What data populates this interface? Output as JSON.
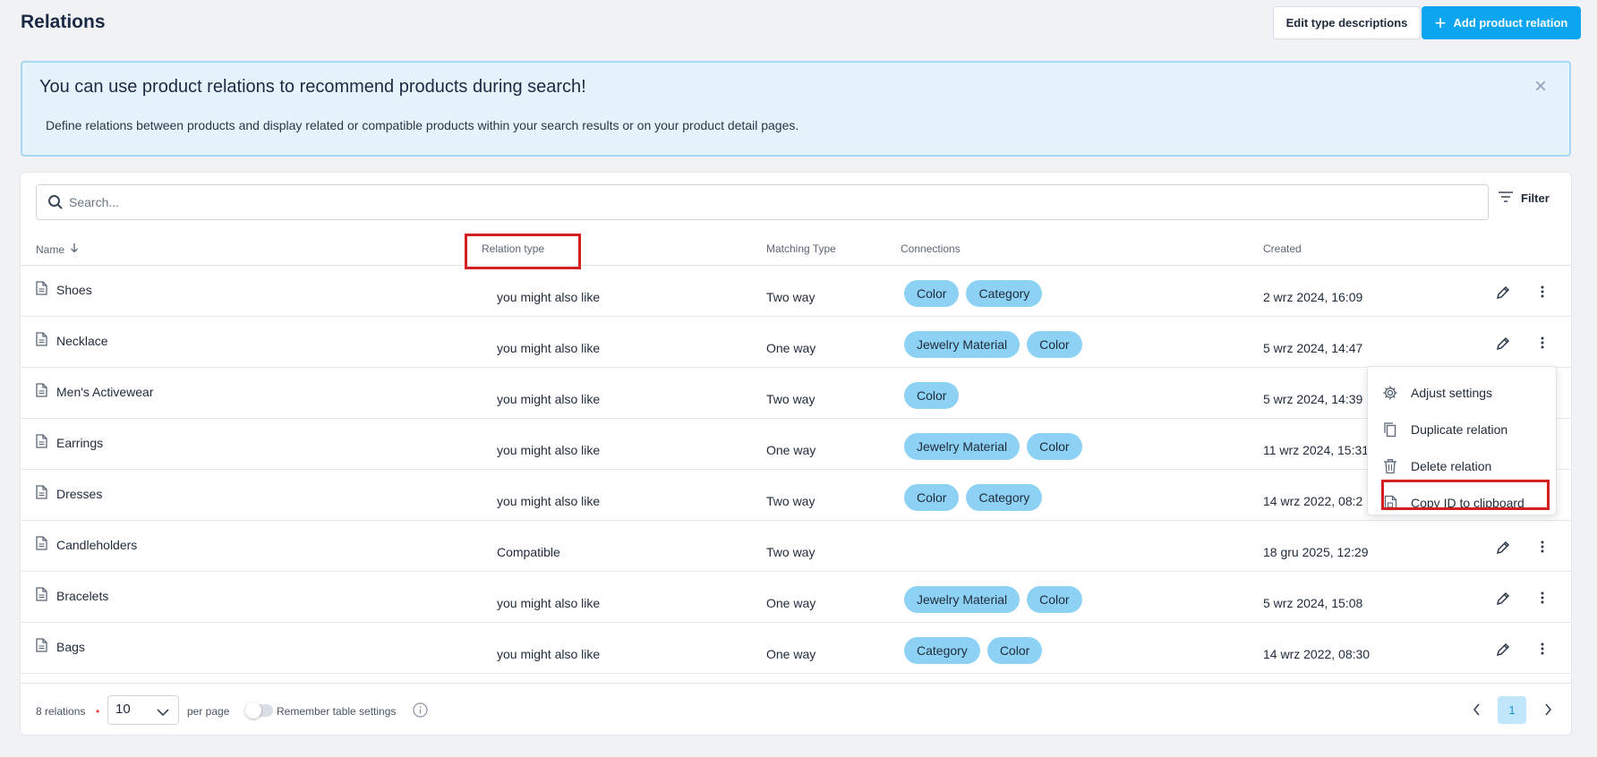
{
  "header": {
    "title": "Relations",
    "edit_button": "Edit type descriptions",
    "add_button": "Add product relation"
  },
  "banner": {
    "title": "You can use product relations to recommend products during search!",
    "text": "Define relations between products and display related or compatible products within your search results or on your product detail pages.",
    "close_glyph": "×"
  },
  "search": {
    "placeholder": "Search..."
  },
  "filter": {
    "label": "Filter"
  },
  "table": {
    "columns": {
      "name": "Name",
      "relation_type": "Relation type",
      "matching_type": "Matching Type",
      "connections": "Connections",
      "created": "Created"
    },
    "rows": [
      {
        "name": "Shoes",
        "relation": "you might also like",
        "matching": "Two way",
        "connections": [
          "Color",
          "Category"
        ],
        "created": "2 wrz 2024, 16:09"
      },
      {
        "name": "Necklace",
        "relation": "you might also like",
        "matching": "One way",
        "connections": [
          "Jewelry Material",
          "Color"
        ],
        "created": "5 wrz 2024, 14:47"
      },
      {
        "name": "Men's Activewear",
        "relation": "you might also like",
        "matching": "Two way",
        "connections": [
          "Color"
        ],
        "created": "5 wrz 2024, 14:39"
      },
      {
        "name": "Earrings",
        "relation": "you might also like",
        "matching": "One way",
        "connections": [
          "Jewelry Material",
          "Color"
        ],
        "created": "11 wrz 2024, 15:31"
      },
      {
        "name": "Dresses",
        "relation": "you might also like",
        "matching": "Two way",
        "connections": [
          "Color",
          "Category"
        ],
        "created": "14 wrz 2022, 08:2"
      },
      {
        "name": "Candleholders",
        "relation": "Compatible",
        "matching": "Two way",
        "connections": [],
        "created": "18 gru 2025, 12:29"
      },
      {
        "name": "Bracelets",
        "relation": "you might also like",
        "matching": "One way",
        "connections": [
          "Jewelry Material",
          "Color"
        ],
        "created": "5 wrz 2024, 15:08"
      },
      {
        "name": "Bags",
        "relation": "you might also like",
        "matching": "One way",
        "connections": [
          "Category",
          "Color"
        ],
        "created": "14 wrz 2022, 08:30"
      }
    ]
  },
  "context_menu": {
    "items": [
      "Adjust settings",
      "Duplicate relation",
      "Delete relation",
      "Copy ID to clipboard"
    ],
    "icons": [
      "gear-icon",
      "copy-icon",
      "trash-icon",
      "clipboard-icon"
    ]
  },
  "footer": {
    "count": "8 relations",
    "dot": "•",
    "per_page_value": "10",
    "per_page_label": "per page",
    "remember_label": "Remember table settings",
    "current_page": "1"
  },
  "colors": {
    "accent": "#0ba5f0",
    "chip": "#8dd2f4",
    "banner_bg": "#e5f4fc",
    "highlight": "#d62020"
  }
}
